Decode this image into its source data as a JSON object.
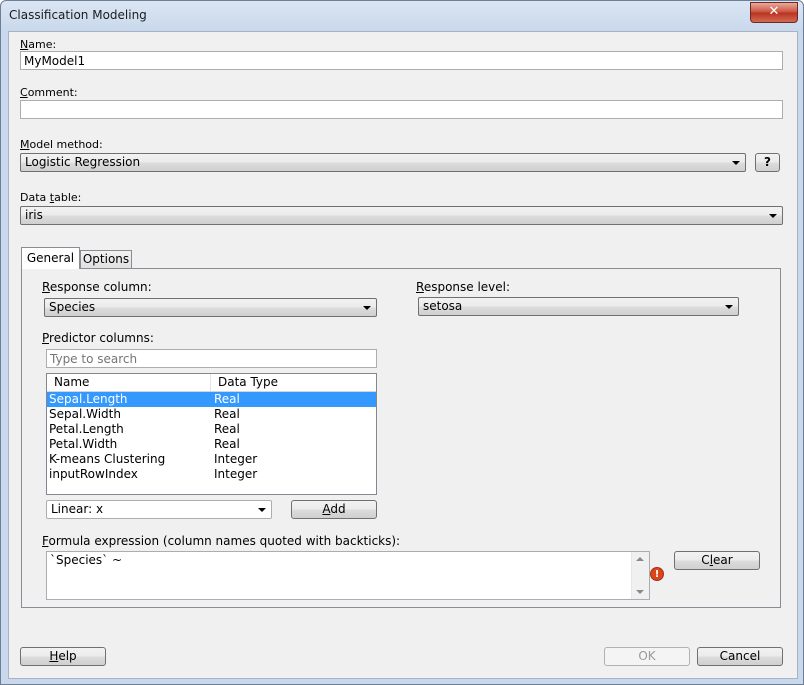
{
  "window": {
    "title": "Classification Modeling",
    "close_glyph": "✕"
  },
  "name_field": {
    "label_prefix": "",
    "label_key": "N",
    "label_rest": "ame:",
    "value": "MyModel1"
  },
  "comment_field": {
    "label_key": "C",
    "label_rest": "omment:",
    "value": ""
  },
  "model_method": {
    "label_key": "M",
    "label_rest": "odel method:",
    "value": "Logistic Regression",
    "help_label": "?"
  },
  "data_table": {
    "label_pre": "Data ",
    "label_key": "t",
    "label_rest": "able:",
    "value": "iris"
  },
  "tabs": [
    {
      "label": "General"
    },
    {
      "label": "Options"
    }
  ],
  "response_column": {
    "label_key": "R",
    "label_rest": "esponse column:",
    "value": "Species"
  },
  "response_level": {
    "label_key": "R",
    "label_rest": "esponse level:",
    "value": "setosa"
  },
  "predictor": {
    "label_key": "P",
    "label_rest": "redictor columns:",
    "search_placeholder": "Type to search",
    "columns": [
      "Name",
      "Data Type"
    ],
    "rows": [
      {
        "name": "Sepal.Length",
        "type": "Real",
        "selected": true
      },
      {
        "name": "Sepal.Width",
        "type": "Real",
        "selected": false
      },
      {
        "name": "Petal.Length",
        "type": "Real",
        "selected": false
      },
      {
        "name": "Petal.Width",
        "type": "Real",
        "selected": false
      },
      {
        "name": "K-means Clustering",
        "type": "Integer",
        "selected": false
      },
      {
        "name": "inputRowIndex",
        "type": "Integer",
        "selected": false
      }
    ],
    "transform_value": "Linear: x",
    "add_label_key": "A",
    "add_label_rest": "dd"
  },
  "formula": {
    "label_key": "F",
    "label_rest": "ormula expression (column names quoted with backticks):",
    "value": "`Species` ~",
    "clear_pre": "C",
    "clear_key": "l",
    "clear_rest": "ear",
    "error_glyph": "!"
  },
  "footer": {
    "help_key": "H",
    "help_rest": "elp",
    "ok_label": "OK",
    "cancel_label": "Cancel"
  },
  "colors": {
    "selection": "#3399ff",
    "error": "#d9461e",
    "close": "#c9503c"
  }
}
